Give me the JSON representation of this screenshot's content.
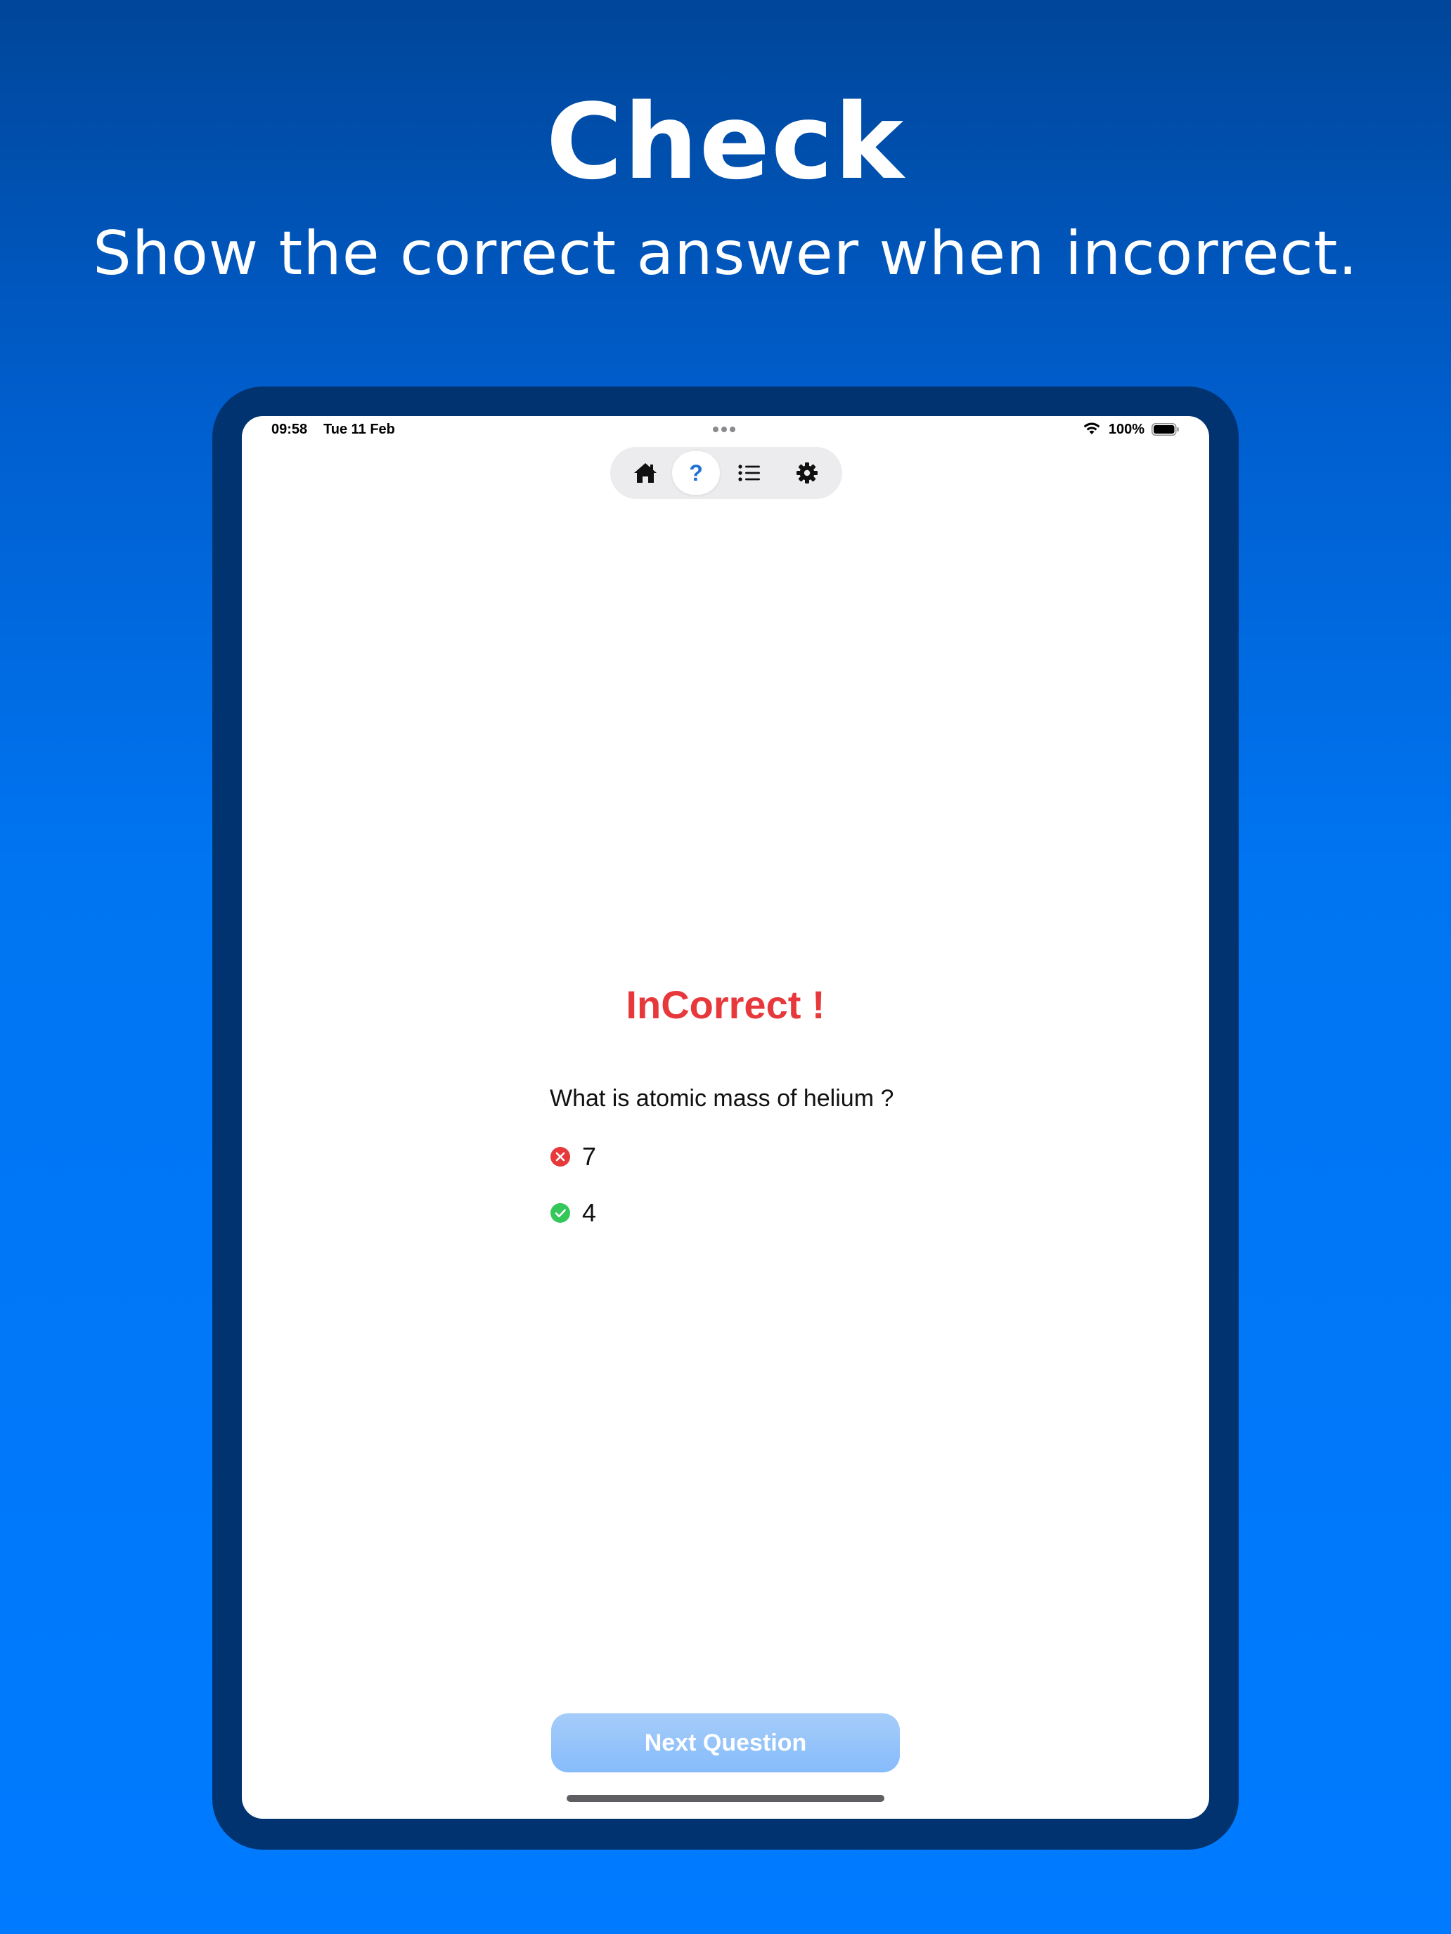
{
  "promo": {
    "headline": "Check",
    "subline": "Show the correct answer when incorrect."
  },
  "status_bar": {
    "time": "09:58",
    "date": "Tue 11 Feb",
    "battery": "100%"
  },
  "tabbar": {
    "tabs": [
      {
        "icon": "home-icon"
      },
      {
        "icon": "question-icon",
        "label": "?",
        "active": true
      },
      {
        "icon": "list-icon"
      },
      {
        "icon": "gear-icon"
      }
    ],
    "accent": "#1f70d6"
  },
  "quiz": {
    "result": "InCorrect !",
    "result_color": "#e7383b",
    "question": "What is atomic mass of helium ?",
    "answers": [
      {
        "value": "7",
        "status": "incorrect",
        "icon": "x-circle-icon",
        "color": "#e7383b"
      },
      {
        "value": "4",
        "status": "correct",
        "icon": "check-circle-icon",
        "color": "#34c759"
      }
    ],
    "next_button": "Next Question"
  }
}
